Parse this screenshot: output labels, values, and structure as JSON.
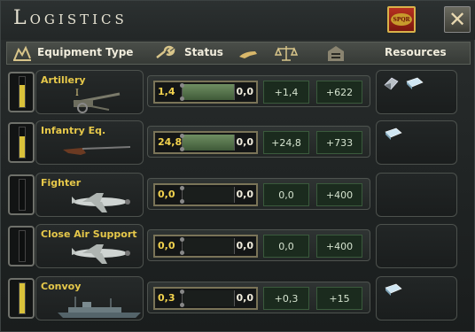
{
  "window": {
    "title": "Logistics",
    "seal_text": "SPQR",
    "close_glyph": "✕"
  },
  "header": {
    "equipment_type_label": "Equipment Type",
    "status_label": "Status",
    "resources_label": "Resources",
    "icons": [
      "logistics-chart-icon",
      "wrench-icon",
      "supply-hand-icon",
      "scales-icon",
      "depot-icon"
    ]
  },
  "rows": [
    {
      "name": "Artillery",
      "marker": "I",
      "picture": "artillery-gun",
      "stock_fraction": 0.75,
      "produced": "1,4",
      "used": "0,0",
      "delta": "+1,4",
      "total": "+622",
      "slider_filled": true,
      "resources": [
        "steel-icon",
        "aluminium-icon"
      ]
    },
    {
      "name": "Infantry Eq.",
      "marker": "",
      "picture": "rifle",
      "stock_fraction": 0.72,
      "produced": "24,8",
      "used": "0,0",
      "delta": "+24,8",
      "total": "+733",
      "slider_filled": true,
      "resources": [
        "steel-icon"
      ]
    },
    {
      "name": "Fighter",
      "marker": "",
      "picture": "fighter-plane",
      "stock_fraction": 0.0,
      "produced": "0,0",
      "used": "0,0",
      "delta": "0,0",
      "total": "+400",
      "slider_filled": false,
      "resources": []
    },
    {
      "name": "Close Air Support",
      "marker": "",
      "picture": "cas-plane",
      "stock_fraction": 0.0,
      "produced": "0,0",
      "used": "0,0",
      "delta": "0,0",
      "total": "+400",
      "slider_filled": false,
      "resources": []
    },
    {
      "name": "Convoy",
      "marker": "",
      "picture": "ship",
      "stock_fraction": 1.0,
      "produced": "0,3",
      "used": "0,0",
      "delta": "+0,3",
      "total": "+15",
      "slider_filled": false,
      "resources": [
        "steel-icon"
      ]
    }
  ],
  "colors": {
    "equipment_name": "#e6c84a",
    "produced_value": "#f3d34e",
    "stock_bar": "#d9c13a",
    "delta_box": "#1b2b1e"
  }
}
